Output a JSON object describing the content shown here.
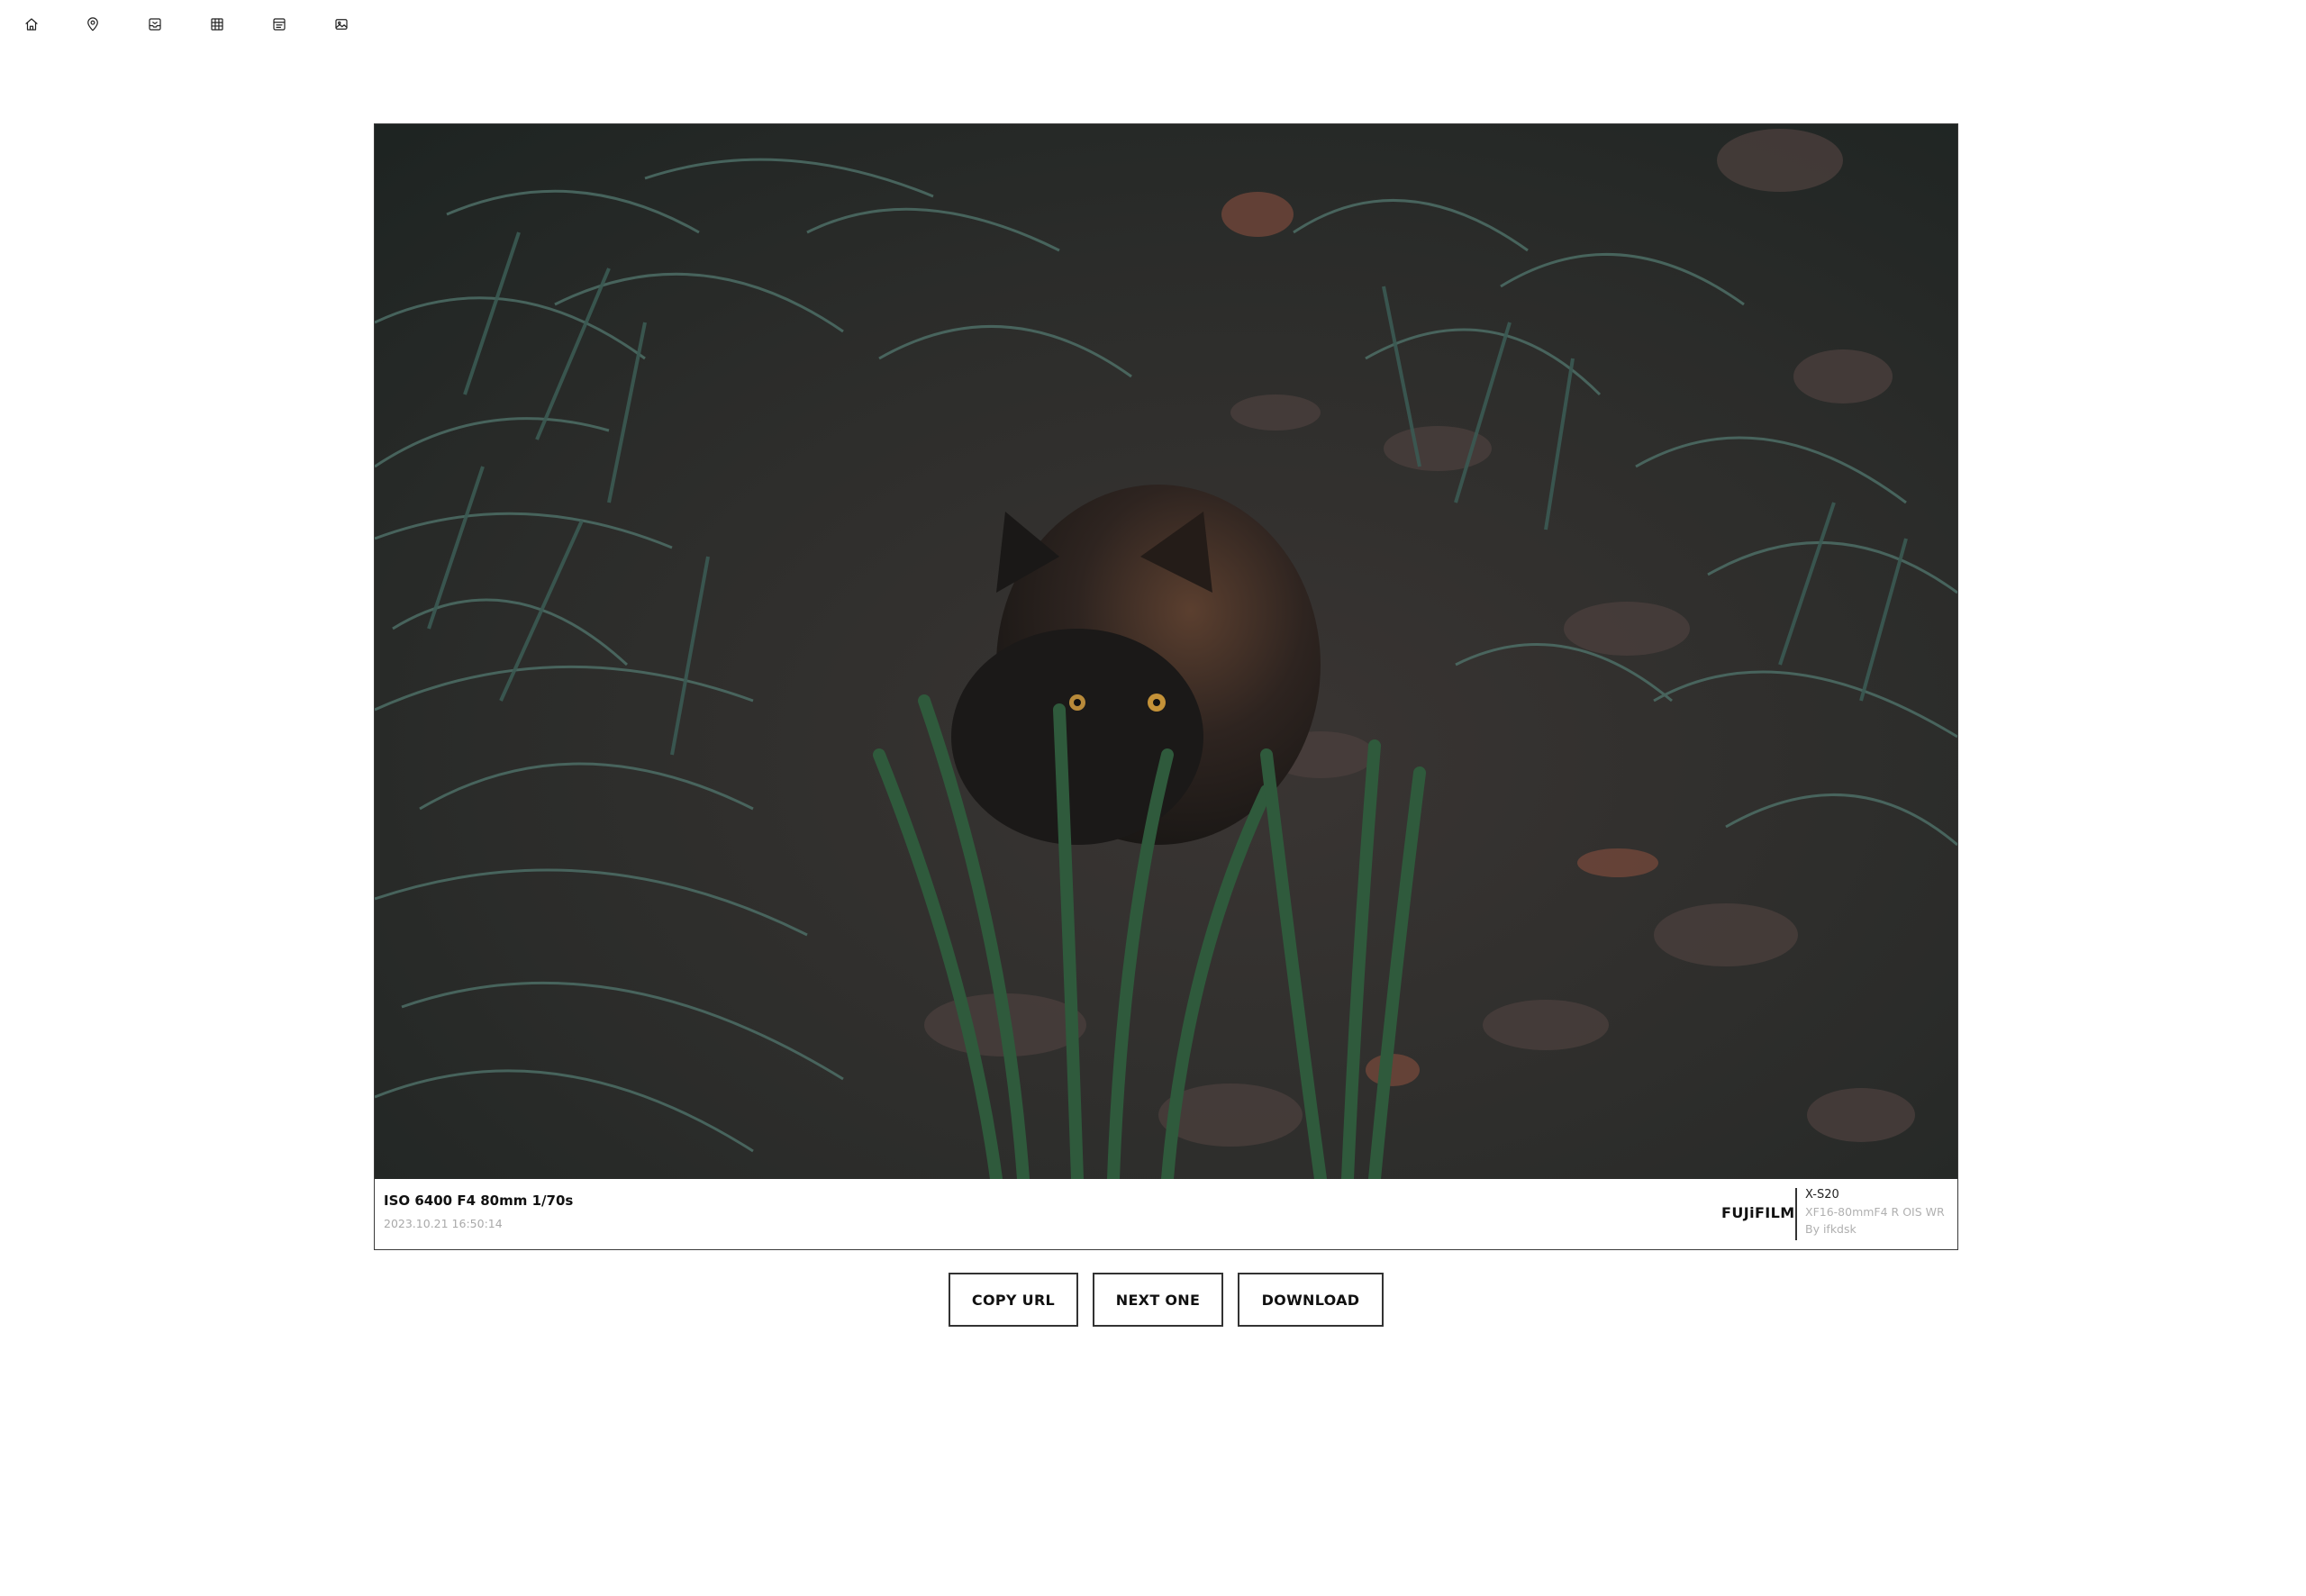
{
  "nav": {
    "items": [
      {
        "id": "home",
        "icon": "home-icon"
      },
      {
        "id": "location",
        "icon": "map-pin-icon"
      },
      {
        "id": "inbox",
        "icon": "inbox-icon"
      },
      {
        "id": "grid",
        "icon": "grid-icon"
      },
      {
        "id": "list",
        "icon": "list-icon"
      },
      {
        "id": "image",
        "icon": "image-icon"
      }
    ]
  },
  "photo": {
    "subject": "tortoiseshell cat in grass"
  },
  "info": {
    "exif": "ISO 6400 F4 80mm 1/70s",
    "datetime": "2023.10.21 16:50:14",
    "brand": "FUJiFILM",
    "model": "X-S20",
    "lens": "XF16-80mmF4 R OIS WR",
    "author": "By ifkdsk"
  },
  "actions": {
    "copy_url": "COPY URL",
    "next_one": "NEXT ONE",
    "download": "DOWNLOAD"
  },
  "colors": {
    "photo_dark": "#2a302c",
    "grass": "#3f5a52",
    "border": "#333333"
  }
}
